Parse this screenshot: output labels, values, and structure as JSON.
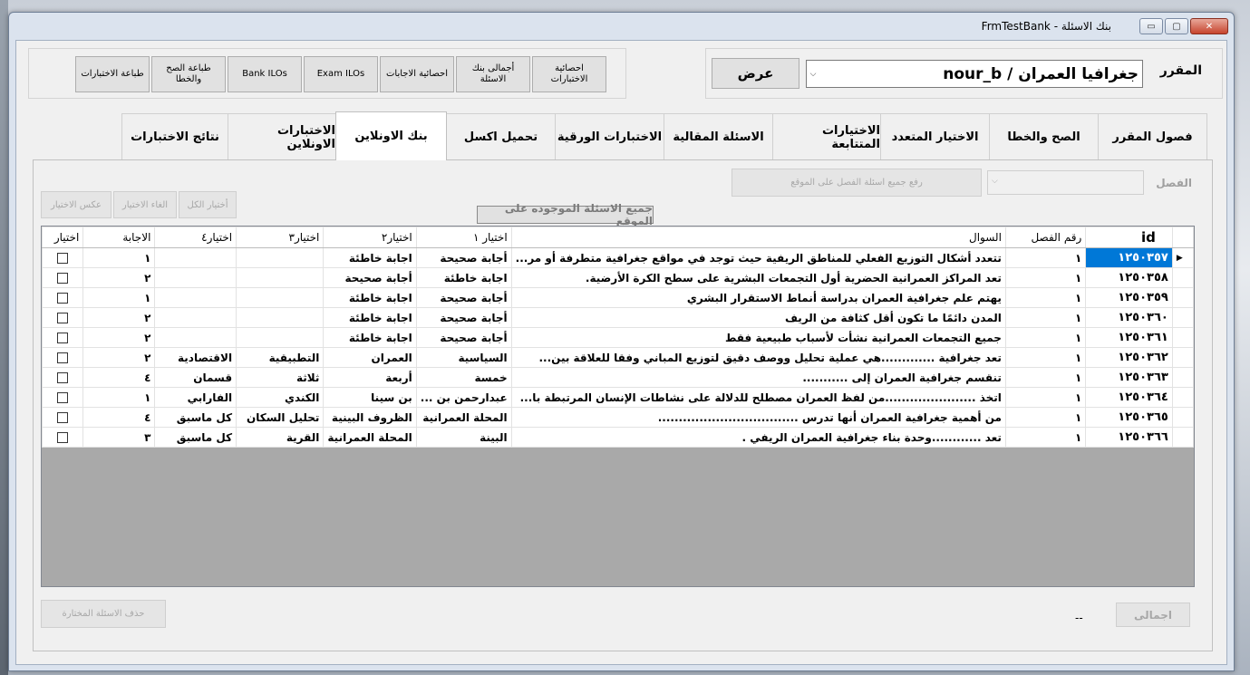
{
  "window": {
    "title": "بنك الاسئلة - FrmTestBank",
    "controls": {
      "minimize": "▭",
      "maximize": "▢",
      "close": "✕"
    }
  },
  "toolbar": {
    "buttons": [
      {
        "label": "احصائية الاختبارات"
      },
      {
        "label": "أجمالى بنك الاسئلة"
      },
      {
        "label": "احصائية الاجابات"
      },
      {
        "label": "Exam ILOs"
      },
      {
        "label": "Bank ILOs"
      },
      {
        "label": "طباعة الصح والخطا"
      },
      {
        "label": "طباعة الاختبارات"
      }
    ]
  },
  "course": {
    "label": "المقرر",
    "selected": "جغرافيا العمران / nour_b",
    "show_button": "عرض"
  },
  "tabs": [
    {
      "label": "فصول المقرر"
    },
    {
      "label": "الصح والخطا"
    },
    {
      "label": "الاختيار المتعدد"
    },
    {
      "label": "الاختيارات المتتابعة"
    },
    {
      "label": "الاسئلة المقالية"
    },
    {
      "label": "الاختبارات الورقية"
    },
    {
      "label": "تحميل اكسل"
    },
    {
      "label": "بنك الاونلاين"
    },
    {
      "label": "الاختبارات الاونلاين"
    },
    {
      "label": "نتائج الاختبارات"
    }
  ],
  "active_tab": "بنك الاونلاين",
  "online_bank": {
    "chapter_label": "الفصل",
    "upload_button": "رفع جميع اسئلة الفصل على الموقع",
    "select_all": "أختيار الكل",
    "cancel_selection": "الغاء الاختيار",
    "invert_selection": "عكس الاختيار",
    "all_on_site_button": "جميع الاسئلة الموجوده على الموقع",
    "delete_selected": "حذف الاسئلة المختارة",
    "total_button": "اجمالى",
    "total_value": "--"
  },
  "table": {
    "columns": {
      "id": "id",
      "chapter": "رقم الفصل",
      "question": "السوال",
      "choice1": "اختيار ١",
      "choice2": "اختيار٢",
      "choice3": "اختيار٣",
      "choice4": "اختيار٤",
      "answer": "الاجابة",
      "select": "اختيار"
    },
    "rows": [
      {
        "id": "١٢٥٠٣٥٧",
        "chapter": "١",
        "question": "تتعدد أشكال التوزيع الفعلي للمناطق الريفية حيث توجد في مواقع جغرافية متطرفة أو مر...",
        "c1": "أجابة صحيحة",
        "c2": "اجابة خاطئة",
        "c3": "",
        "c4": "",
        "answer": "١"
      },
      {
        "id": "١٢٥٠٣٥٨",
        "chapter": "١",
        "question": "تعد المراكز العمرانية الحضرية أول التجمعات البشرية على سطح الكرة الأرضية.",
        "c1": "اجابة خاطئة",
        "c2": "أجابة صحيحة",
        "c3": "",
        "c4": "",
        "answer": "٢"
      },
      {
        "id": "١٢٥٠٣٥٩",
        "chapter": "١",
        "question": "يهتم علم جغرافية العمران بدراسة أنماط الاستقرار البشري",
        "c1": "أجابة صحيحة",
        "c2": "اجابة خاطئة",
        "c3": "",
        "c4": "",
        "answer": "١"
      },
      {
        "id": "١٢٥٠٣٦٠",
        "chapter": "١",
        "question": "المدن دائمًا ما تكون أقل كثافة من الريف",
        "c1": "أجابة صحيحة",
        "c2": "اجابة خاطئة",
        "c3": "",
        "c4": "",
        "answer": "٢"
      },
      {
        "id": "١٢٥٠٣٦١",
        "chapter": "١",
        "question": "جميع التجمعات العمرانية نشأت لأسباب طبيعية فقط",
        "c1": "أجابة صحيحة",
        "c2": "اجابة خاطئة",
        "c3": "",
        "c4": "",
        "answer": "٢"
      },
      {
        "id": "١٢٥٠٣٦٢",
        "chapter": "١",
        "question": "تعد جغرافية .............هي عملية تحليل ووصف دقيق لتوزيع المباني وفقا للعلاقة بين...",
        "c1": "السياسية",
        "c2": "العمران",
        "c3": "التطبيقية",
        "c4": "الاقتصادية",
        "answer": "٢"
      },
      {
        "id": "١٢٥٠٣٦٣",
        "chapter": "١",
        "question": "تنقسم جغرافية العمران إلى ...........",
        "c1": "خمسة",
        "c2": "أربعة",
        "c3": "ثلاثة",
        "c4": "قسمان",
        "answer": "٤"
      },
      {
        "id": "١٢٥٠٣٦٤",
        "chapter": "١",
        "question": "اتخذ ......................من لفظ العمران مصطلح للدلالة على نشاطات الإنسان المرتبطة با...",
        "c1": "عبدارحمن بن ...",
        "c2": "بن سينا",
        "c3": "الكندي",
        "c4": "الفارابي",
        "answer": "١"
      },
      {
        "id": "١٢٥٠٣٦٥",
        "chapter": "١",
        "question": "من أهمية جغرافية العمران أنها تدرس ..................................",
        "c1": "المحلة العمرانية",
        "c2": "الظروف البينية",
        "c3": "تحليل السكان",
        "c4": "كل ماسبق",
        "answer": "٤"
      },
      {
        "id": "١٢٥٠٣٦٦",
        "chapter": "١",
        "question": "تعد ............وحدة بناء جغرافية العمران الريفي .",
        "c1": "البينة",
        "c2": "المحلة العمرانية",
        "c3": "القرية",
        "c4": "كل ماسبق",
        "answer": "٣"
      }
    ],
    "selected_row": 0
  },
  "colors": {
    "selection": "#0078d7",
    "grid_background": "#a9a9a9"
  }
}
